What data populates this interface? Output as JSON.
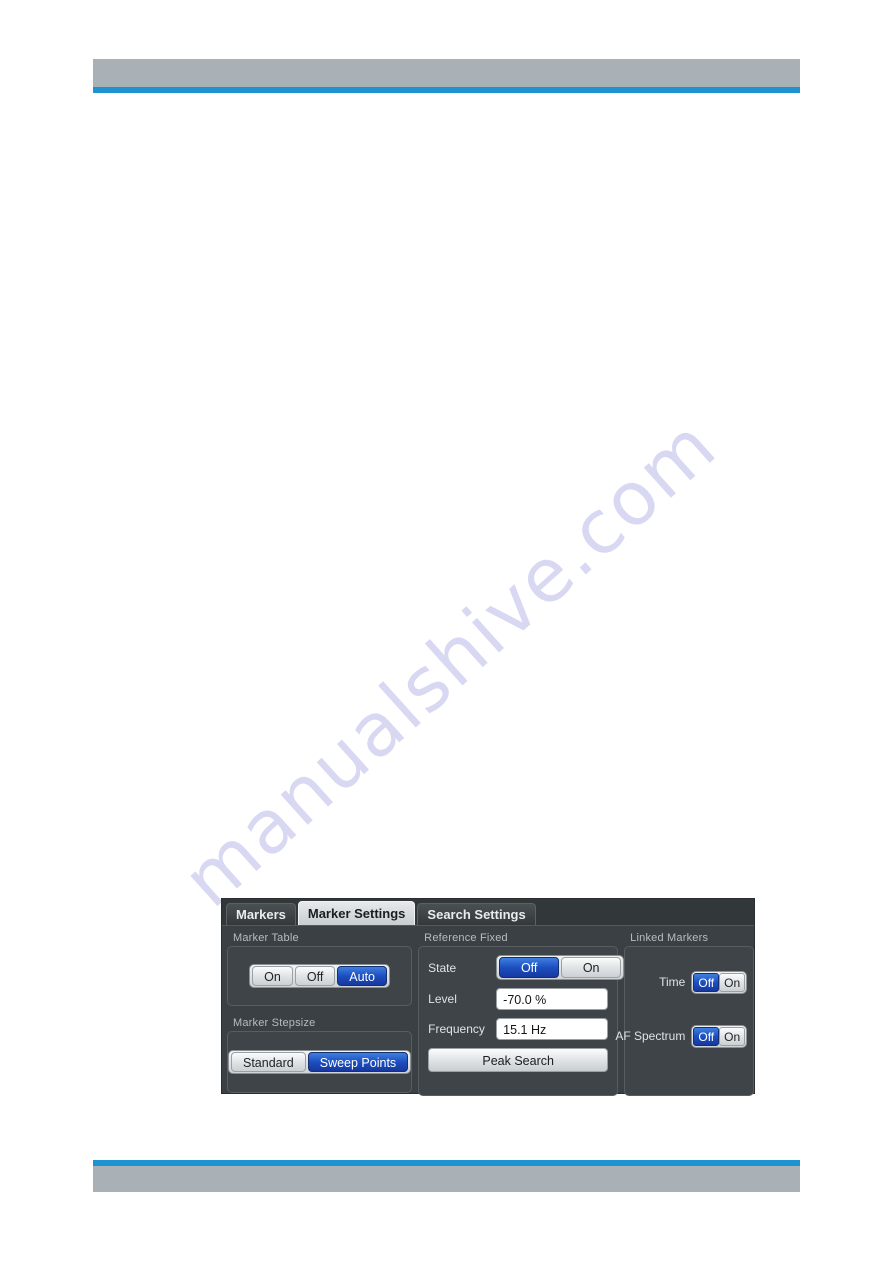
{
  "page": {
    "watermark": "manualshive.com",
    "accent_color": "#1d93d2",
    "header_bar_color": "#a9b1b6"
  },
  "dialog": {
    "tabs": [
      {
        "label": "Markers",
        "active": false
      },
      {
        "label": "Marker Settings",
        "active": true
      },
      {
        "label": "Search Settings",
        "active": false
      }
    ],
    "marker_table": {
      "title": "Marker Table",
      "options": [
        {
          "label": "On",
          "selected": false
        },
        {
          "label": "Off",
          "selected": false
        },
        {
          "label": "Auto",
          "selected": true
        }
      ]
    },
    "marker_stepsize": {
      "title": "Marker Stepsize",
      "options": [
        {
          "label": "Standard",
          "selected": false
        },
        {
          "label": "Sweep Points",
          "selected": true
        }
      ]
    },
    "reference_fixed": {
      "title": "Reference Fixed",
      "state": {
        "label": "State",
        "options": [
          {
            "label": "Off",
            "selected": true
          },
          {
            "label": "On",
            "selected": false
          }
        ]
      },
      "level": {
        "label": "Level",
        "value": "-70.0 %"
      },
      "frequency": {
        "label": "Frequency",
        "value": "15.1 Hz"
      },
      "peak_search_label": "Peak Search"
    },
    "linked_markers": {
      "title": "Linked Markers",
      "rows": [
        {
          "label": "Time",
          "options": [
            {
              "label": "Off",
              "selected": true
            },
            {
              "label": "On",
              "selected": false
            }
          ]
        },
        {
          "label": "AF Spectrum",
          "options": [
            {
              "label": "Off",
              "selected": true
            },
            {
              "label": "On",
              "selected": false
            }
          ]
        }
      ]
    }
  }
}
